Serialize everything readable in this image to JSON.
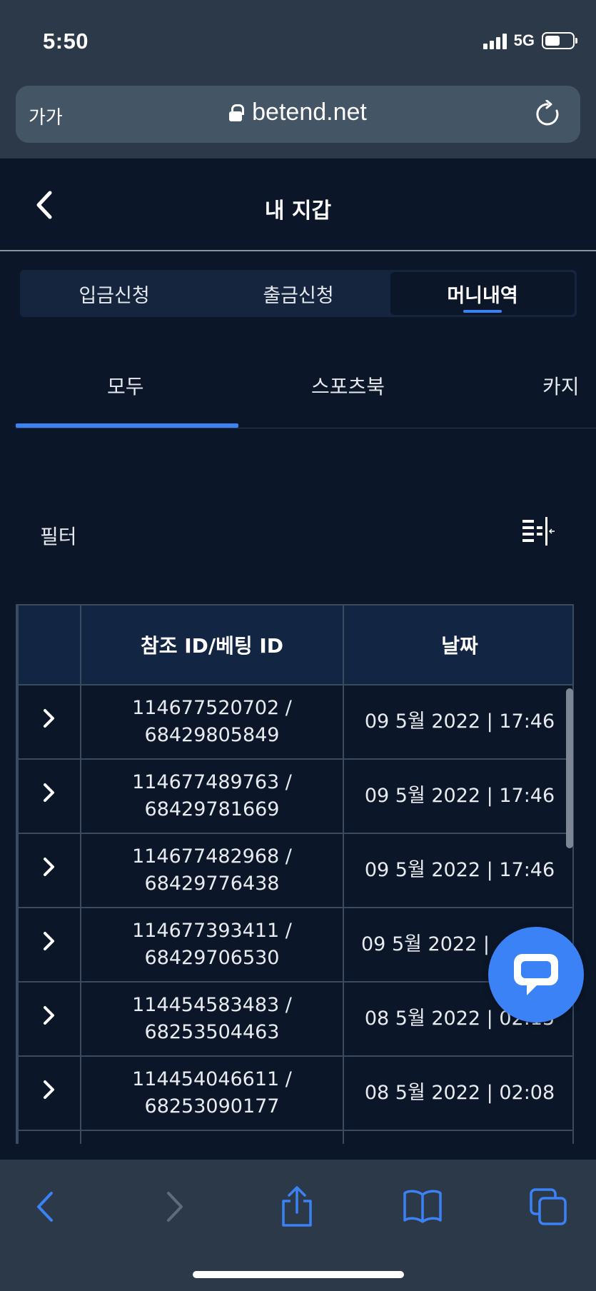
{
  "status_bar": {
    "time": "5:50",
    "network": "5G",
    "battery_level": 0.55
  },
  "browser": {
    "text_size_label": "가가",
    "url": "betend.net"
  },
  "header": {
    "title": "내 지갑"
  },
  "segment_tabs": [
    {
      "label": "입금신청",
      "active": false
    },
    {
      "label": "출금신청",
      "active": false
    },
    {
      "label": "머니내역",
      "active": true
    }
  ],
  "category_tabs": [
    {
      "label": "모두",
      "active": true
    },
    {
      "label": "스포츠북",
      "active": false
    },
    {
      "label": "카지",
      "active": false
    }
  ],
  "filter": {
    "label": "필터"
  },
  "table": {
    "columns": [
      "",
      "참조 ID/베팅 ID",
      "날짜"
    ],
    "rows": [
      {
        "ref_line1": "114677520702 /",
        "ref_line2": "68429805849",
        "date": "09 5월 2022 | 17:46"
      },
      {
        "ref_line1": "114677489763 /",
        "ref_line2": "68429781669",
        "date": "09 5월 2022 | 17:46"
      },
      {
        "ref_line1": "114677482968 /",
        "ref_line2": "68429776438",
        "date": "09 5월 2022 | 17:46"
      },
      {
        "ref_line1": "114677393411 /",
        "ref_line2": "68429706530",
        "date": "09 5월 2022 |"
      },
      {
        "ref_line1": "114454583483 /",
        "ref_line2": "68253504463",
        "date": "08 5월 2022 | 02:15"
      },
      {
        "ref_line1": "114454046611 /",
        "ref_line2": "68253090177",
        "date": "08 5월 2022 | 02:08"
      },
      {
        "ref_line1": "",
        "ref_line2": "",
        "date": ""
      }
    ]
  },
  "colors": {
    "background": "#0b1729",
    "chrome": "#2c3949",
    "accent": "#3b82f6",
    "header_cell": "#122542"
  },
  "icons": {
    "back": "chevron-left-icon",
    "row_expand": "chevron-right-icon",
    "filter": "filter-sort-icon",
    "chat": "chat-bubble-icon",
    "toolbar": [
      "back-arrow-icon",
      "forward-arrow-icon",
      "share-icon",
      "bookmarks-icon",
      "tabs-icon"
    ]
  }
}
